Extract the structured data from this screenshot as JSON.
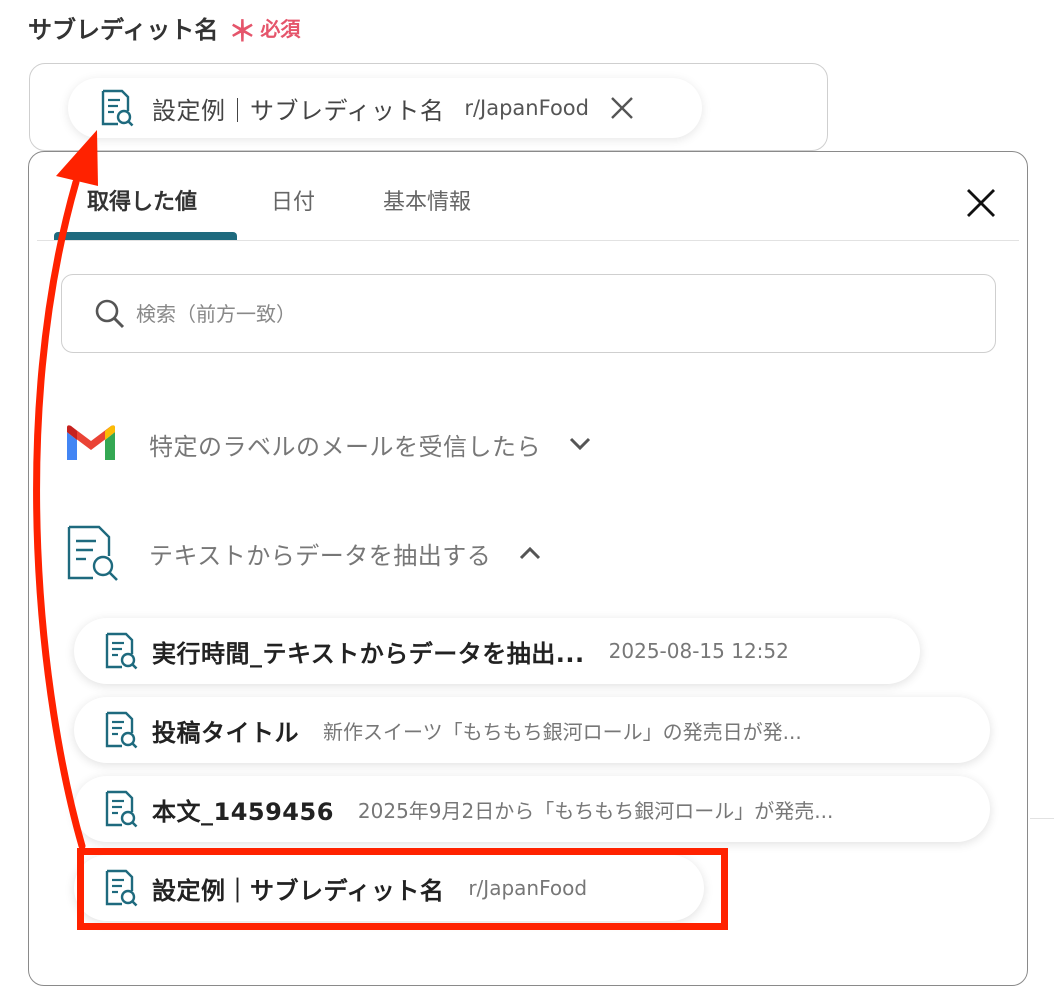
{
  "field": {
    "label": "サブレディット名",
    "required_star": "＊",
    "required_text": "必須"
  },
  "selected_chip": {
    "name": "設定例｜サブレディット名",
    "value": "r/JapanFood"
  },
  "panel": {
    "tabs": [
      {
        "label": "取得した値",
        "active": true
      },
      {
        "label": "日付",
        "active": false
      },
      {
        "label": "基本情報",
        "active": false
      }
    ],
    "search_placeholder": "検索（前方一致）",
    "groups": [
      {
        "title": "特定のラベルのメールを受信したら",
        "icon": "gmail-icon",
        "expanded": false
      },
      {
        "title": "テキストからデータを抽出する",
        "icon": "document-search-icon",
        "expanded": true
      }
    ],
    "items": [
      {
        "name": "実行時間_テキストからデータを抽出...",
        "value": "2025-08-15 12:52"
      },
      {
        "name": "投稿タイトル",
        "value": "新作スイーツ「もちもち銀河ロール」の発売日が発..."
      },
      {
        "name": "本文_1459456",
        "value": "2025年9月2日から「もちもち銀河ロール」が発売..."
      },
      {
        "name": "設定例｜サブレディット名",
        "value": "r/JapanFood"
      }
    ]
  },
  "colors": {
    "accent": "#1e6a7e",
    "required": "#e5556b",
    "annotation": "#ff2200"
  }
}
